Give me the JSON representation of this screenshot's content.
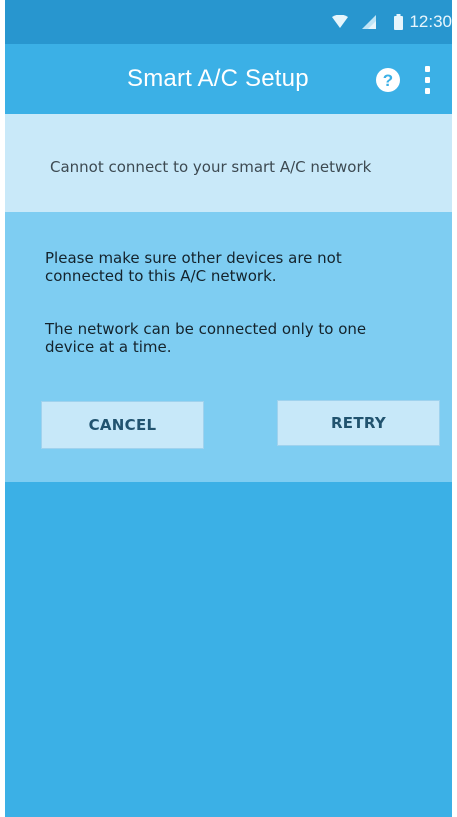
{
  "status_bar": {
    "time": "12:30",
    "icons": [
      "wifi-icon",
      "signal-icon",
      "battery-icon"
    ]
  },
  "app_bar": {
    "title": "Smart A/C Setup",
    "help_icon": "help-icon",
    "help_glyph": "?",
    "overflow_icon": "more-vert-icon"
  },
  "banner": {
    "message": "Cannot connect to your smart A/C network"
  },
  "dialog": {
    "paragraph_1": "Please make sure other devices are not\nconnected to this A/C network.",
    "paragraph_2": "The network can be connected only to one\ndevice at a time.",
    "cancel_label": "CANCEL",
    "retry_label": "RETRY"
  },
  "colors": {
    "status_bar": "#2896cf",
    "primary": "#3bb0e6",
    "banner": "#c9e9f9",
    "dialog_panel": "#7ecdf2",
    "button": "#c7e8f9",
    "button_text": "#21536f"
  }
}
